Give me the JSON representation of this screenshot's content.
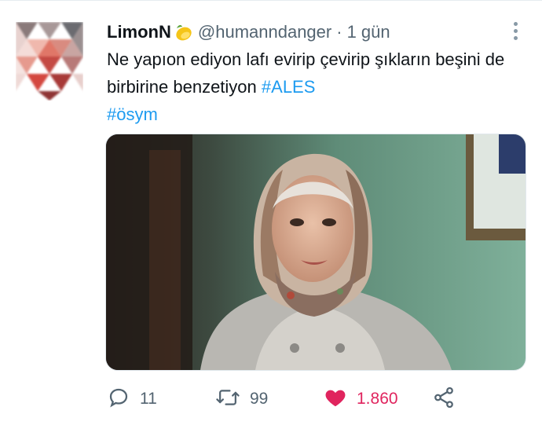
{
  "tweet": {
    "display_name": "LimonN",
    "name_emoji": "lemon-emoji",
    "handle": "@humanndanger",
    "separator": "·",
    "time": "1 gün",
    "text_main": "Ne yapıon ediyon lafı evirip çevirip şıkların beşini de birbirine benzetiyon ",
    "hashtag_1": "#ALES",
    "hashtag_2": "#ösym",
    "media": {
      "type": "photo",
      "description_icon": "photo-image"
    }
  },
  "actions": {
    "reply_count": "11",
    "retweet_count": "99",
    "like_count": "1.860",
    "liked": true
  },
  "colors": {
    "accent": "#1d9bf0",
    "like": "#e0245e",
    "secondary_text": "#536471"
  }
}
